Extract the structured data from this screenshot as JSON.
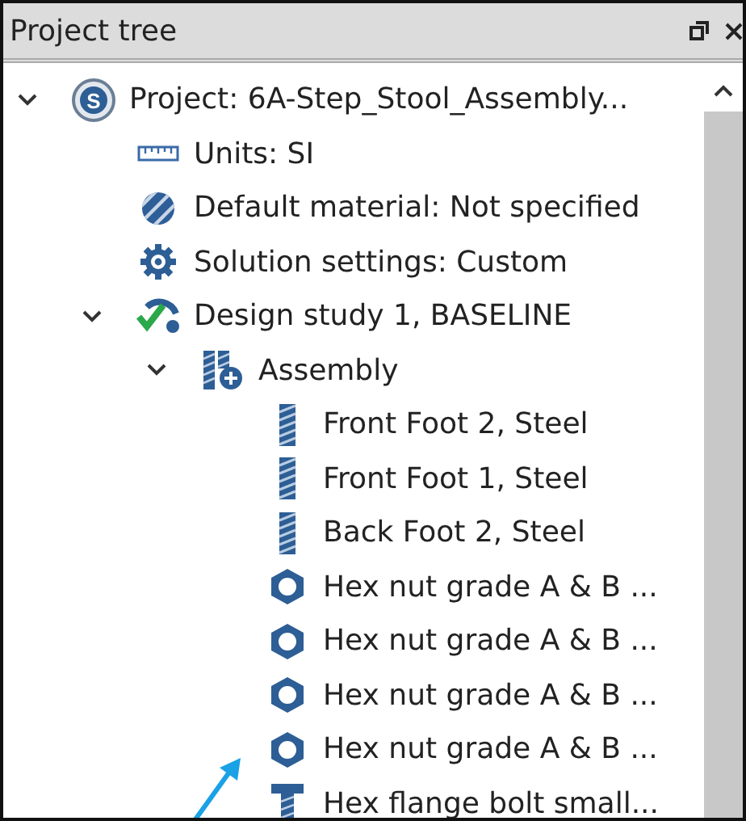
{
  "panel": {
    "title": "Project tree"
  },
  "tree": [
    {
      "kind": "project",
      "icon_letter": "S",
      "label": "Project: 6A-Step_Stool_Assembly...",
      "expanded": true,
      "children": [
        {
          "kind": "units",
          "label": "Units: SI"
        },
        {
          "kind": "material",
          "label": "Default material: Not specified"
        },
        {
          "kind": "settings",
          "label": "Solution settings: Custom"
        },
        {
          "kind": "study",
          "label": "Design study 1, BASELINE",
          "expanded": true,
          "children": [
            {
              "kind": "assembly",
              "label": "Assembly",
              "expanded": true,
              "children": [
                {
                  "kind": "part",
                  "label": "Front Foot 2, Steel"
                },
                {
                  "kind": "part",
                  "label": "Front Foot 1, Steel"
                },
                {
                  "kind": "part",
                  "label": "Back Foot 2, Steel"
                },
                {
                  "kind": "nut",
                  "label": "Hex nut grade A & B ..."
                },
                {
                  "kind": "nut",
                  "label": "Hex nut grade A & B ..."
                },
                {
                  "kind": "nut",
                  "label": "Hex nut grade A & B ..."
                },
                {
                  "kind": "nut",
                  "label": "Hex nut grade A & B ..."
                },
                {
                  "kind": "bolt",
                  "label": "Hex flange bolt small..."
                }
              ]
            }
          ]
        }
      ]
    }
  ]
}
